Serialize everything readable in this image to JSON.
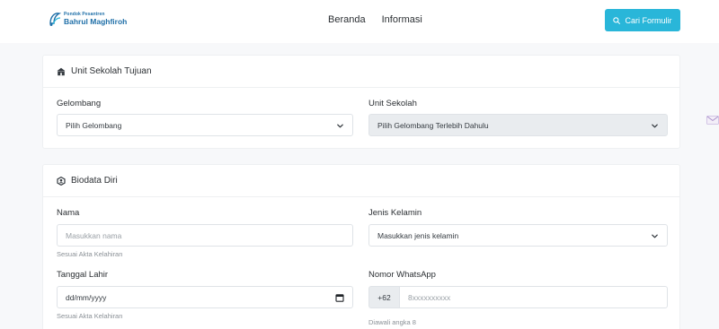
{
  "nav": {
    "logo_small": "Pondok Pesantren",
    "logo_big": "Bahrul Maghfiroh",
    "links": [
      "Beranda",
      "Informasi"
    ],
    "search_button": "Cari Formulir",
    "search_icon": "search-icon",
    "accent_color": "#29b6d9"
  },
  "unit": {
    "title": "Unit Sekolah Tujuan",
    "icon": "school-icon",
    "gelombang_label": "Gelombang",
    "gelombang_value": "Pilih Gelombang",
    "unit_label": "Unit Sekolah",
    "unit_value": "Pilih Gelombang Terlebih Dahulu"
  },
  "biodata": {
    "title": "Biodata Diri",
    "icon": "badge-icon",
    "nama_label": "Nama",
    "nama_placeholder": "Masukkan nama",
    "nama_help": "Sesuai Akta Kelahiran",
    "jk_label": "Jenis Kelamin",
    "jk_value": "Masukkan jenis kelamin",
    "tgl_label": "Tanggal Lahir",
    "tgl_value": "dd/mm/yyyy",
    "tgl_help": "Sesuai Akta Kelahiran",
    "wa_label": "Nomor WhatsApp",
    "wa_prefix": "+62",
    "wa_placeholder": "8xxxxxxxxxx",
    "wa_help": "Diawali angka 8"
  }
}
